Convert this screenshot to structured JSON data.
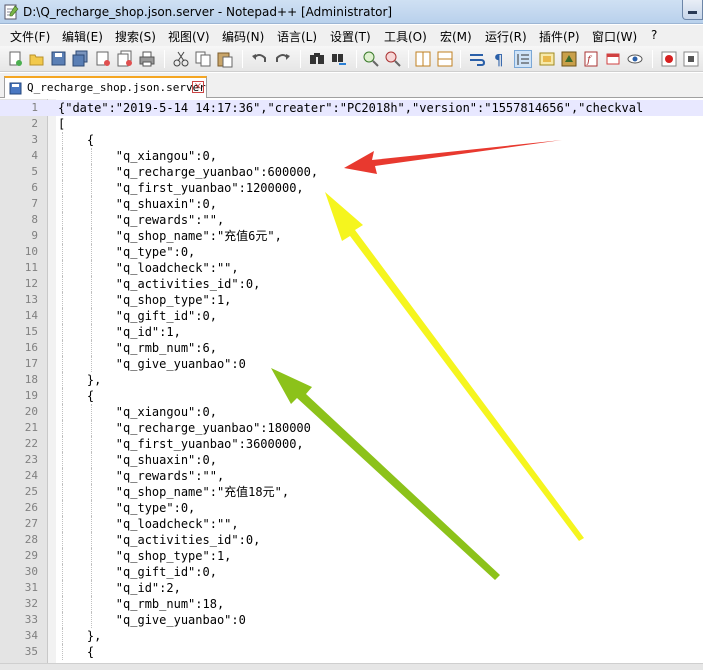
{
  "window": {
    "title": "D:\\Q_recharge_shop.json.server - Notepad++ [Administrator]"
  },
  "menu": [
    "文件(F)",
    "编辑(E)",
    "搜索(S)",
    "视图(V)",
    "编码(N)",
    "语言(L)",
    "设置(T)",
    "工具(O)",
    "宏(M)",
    "运行(R)",
    "插件(P)",
    "窗口(W)",
    "?"
  ],
  "tab": {
    "label": "Q_recharge_shop.json.server",
    "close_glyph": "×"
  },
  "editor": {
    "current_line": 1,
    "lines": [
      {
        "n": "1",
        "text": "{\"date\":\"2019-5-14 14:17:36\",\"creater\":\"PC2018h\",\"version\":\"1557814656\",\"checkval"
      },
      {
        "n": "2",
        "text": "["
      },
      {
        "n": "3",
        "text": "    {"
      },
      {
        "n": "4",
        "text": "        \"q_xiangou\":0,"
      },
      {
        "n": "5",
        "text": "        \"q_recharge_yuanbao\":600000,"
      },
      {
        "n": "6",
        "text": "        \"q_first_yuanbao\":1200000,"
      },
      {
        "n": "7",
        "text": "        \"q_shuaxin\":0,"
      },
      {
        "n": "8",
        "text": "        \"q_rewards\":\"\","
      },
      {
        "n": "9",
        "text": "        \"q_shop_name\":\"充值6元\","
      },
      {
        "n": "10",
        "text": "        \"q_type\":0,"
      },
      {
        "n": "11",
        "text": "        \"q_loadcheck\":\"\","
      },
      {
        "n": "12",
        "text": "        \"q_activities_id\":0,"
      },
      {
        "n": "13",
        "text": "        \"q_shop_type\":1,"
      },
      {
        "n": "14",
        "text": "        \"q_gift_id\":0,"
      },
      {
        "n": "15",
        "text": "        \"q_id\":1,"
      },
      {
        "n": "16",
        "text": "        \"q_rmb_num\":6,"
      },
      {
        "n": "17",
        "text": "        \"q_give_yuanbao\":0"
      },
      {
        "n": "18",
        "text": "    },"
      },
      {
        "n": "19",
        "text": "    {"
      },
      {
        "n": "20",
        "text": "        \"q_xiangou\":0,"
      },
      {
        "n": "21",
        "text": "        \"q_recharge_yuanbao\":180000"
      },
      {
        "n": "22",
        "text": "        \"q_first_yuanbao\":3600000,"
      },
      {
        "n": "23",
        "text": "        \"q_shuaxin\":0,"
      },
      {
        "n": "24",
        "text": "        \"q_rewards\":\"\","
      },
      {
        "n": "25",
        "text": "        \"q_shop_name\":\"充值18元\","
      },
      {
        "n": "26",
        "text": "        \"q_type\":0,"
      },
      {
        "n": "27",
        "text": "        \"q_loadcheck\":\"\","
      },
      {
        "n": "28",
        "text": "        \"q_activities_id\":0,"
      },
      {
        "n": "29",
        "text": "        \"q_shop_type\":1,"
      },
      {
        "n": "30",
        "text": "        \"q_gift_id\":0,"
      },
      {
        "n": "31",
        "text": "        \"q_id\":2,"
      },
      {
        "n": "32",
        "text": "        \"q_rmb_num\":18,"
      },
      {
        "n": "33",
        "text": "        \"q_give_yuanbao\":0"
      },
      {
        "n": "34",
        "text": "    },"
      },
      {
        "n": "35",
        "text": "    {"
      }
    ]
  },
  "annotations": [
    {
      "name": "red-arrow",
      "color": "#e8392f"
    },
    {
      "name": "yellow-arrow",
      "color": "#f5f51e"
    },
    {
      "name": "green-arrow",
      "color": "#8cc21a"
    }
  ],
  "toolbar_icons": [
    "new-file-icon",
    "open-file-icon",
    "save-icon",
    "save-all-icon",
    "close-icon",
    "close-all-icon",
    "print-icon",
    "cut-icon",
    "copy-icon",
    "paste-icon",
    "undo-icon",
    "redo-icon",
    "find-icon",
    "replace-icon",
    "zoom-in-icon",
    "zoom-out-icon",
    "sync-vertical-icon",
    "sync-horizontal-icon",
    "word-wrap-icon",
    "show-all-chars-icon",
    "indent-guide-icon",
    "user-language-icon",
    "doc-map-icon",
    "function-list-icon",
    "folder-workspace-icon",
    "monitor-icon",
    "record-macro-icon",
    "stop-record-icon"
  ]
}
